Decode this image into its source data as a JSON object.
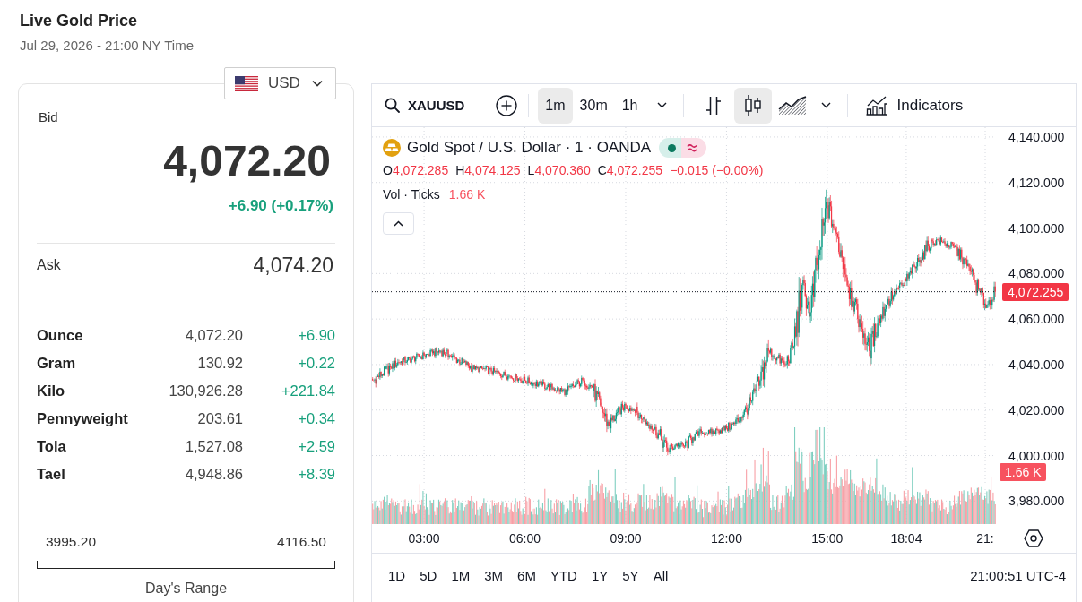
{
  "header": {
    "title": "Live Gold Price",
    "timestamp": "Jul 29, 2026 - 21:00 NY Time"
  },
  "currency": {
    "code": "USD"
  },
  "quote": {
    "bid_label": "Bid",
    "bid": "4,072.20",
    "change": "+6.90 (+0.17%)",
    "ask_label": "Ask",
    "ask": "4,074.20"
  },
  "units": [
    {
      "name": "Ounce",
      "price": "4,072.20",
      "change": "+6.90"
    },
    {
      "name": "Gram",
      "price": "130.92",
      "change": "+0.22"
    },
    {
      "name": "Kilo",
      "price": "130,926.28",
      "change": "+221.84"
    },
    {
      "name": "Pennyweight",
      "price": "203.61",
      "change": "+0.34"
    },
    {
      "name": "Tola",
      "price": "1,527.08",
      "change": "+2.59"
    },
    {
      "name": "Tael",
      "price": "4,948.86",
      "change": "+8.39"
    }
  ],
  "days_range": {
    "low": "3995.20",
    "high": "4116.50",
    "label": "Day's Range"
  },
  "chart_widget": {
    "toolbar": {
      "symbol": "XAUUSD",
      "intervals": [
        {
          "label": "1m",
          "selected": true
        },
        {
          "label": "30m",
          "selected": false
        },
        {
          "label": "1h",
          "selected": false
        }
      ],
      "chart_types": [
        {
          "kind": "bars",
          "selected": false
        },
        {
          "kind": "candles",
          "selected": true
        },
        {
          "kind": "area",
          "selected": false
        }
      ],
      "indicators": "Indicators"
    },
    "legend": {
      "title": "Gold Spot / U.S. Dollar · 1 · OANDA",
      "ohlc": [
        {
          "key": "O",
          "value": "4,072.285"
        },
        {
          "key": "H",
          "value": "4,074.125"
        },
        {
          "key": "L",
          "value": "4,070.360"
        },
        {
          "key": "C",
          "value": "4,072.255"
        }
      ],
      "change": "−0.015 (−0.00%)",
      "volume_label": "Vol · Ticks",
      "volume_value": "1.66 K"
    },
    "price_axis": {
      "labels": [
        "4,140.000",
        "4,120.000",
        "4,100.000",
        "4,080.000",
        "4,060.000",
        "4,040.000",
        "4,020.000",
        "4,000.000",
        "3,980.000"
      ],
      "last_price": "4,072.255",
      "last_volume": "1.66 K"
    },
    "time_axis": {
      "labels": [
        "03:00",
        "06:00",
        "09:00",
        "12:00",
        "15:00",
        "18:04",
        "21:"
      ]
    },
    "ranges": [
      {
        "label": "1D",
        "selected": false
      },
      {
        "label": "5D",
        "selected": false
      },
      {
        "label": "1M",
        "selected": false
      },
      {
        "label": "3M",
        "selected": false
      },
      {
        "label": "6M",
        "selected": false
      },
      {
        "label": "YTD",
        "selected": false
      },
      {
        "label": "1Y",
        "selected": false
      },
      {
        "label": "5Y",
        "selected": false
      },
      {
        "label": "All",
        "selected": false
      }
    ],
    "clock": "21:00:51 UTC-4"
  }
}
